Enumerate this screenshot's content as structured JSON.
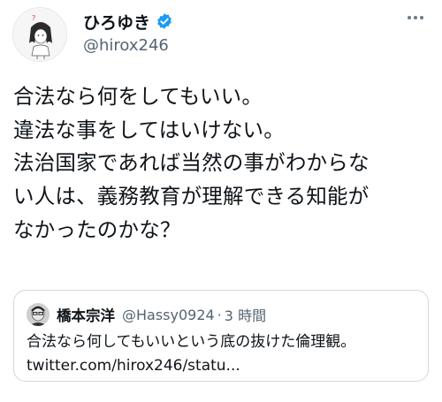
{
  "author": {
    "display_name": "ひろゆき",
    "handle": "@hirox246",
    "avatar_icon": "avatar-illustration-icon",
    "verified_icon": "verified-badge-icon",
    "verified_color": "#1d9bf0"
  },
  "more_icon": "more-options-icon",
  "tweet": {
    "text": "合法なら何をしてもいい。\n違法な事をしてはいけない。\n法治国家であれば当然の事がわからな\nい人は、義務教育が理解できる知能が\nなかったのかな？"
  },
  "quote": {
    "display_name": "橋本宗洋",
    "handle": "@Hassy0924",
    "separator": "·",
    "time": "3 時間",
    "text": "合法なら何してもいいという底の抜けた倫理観。",
    "link": "twitter.com/hirox246/statu..."
  }
}
